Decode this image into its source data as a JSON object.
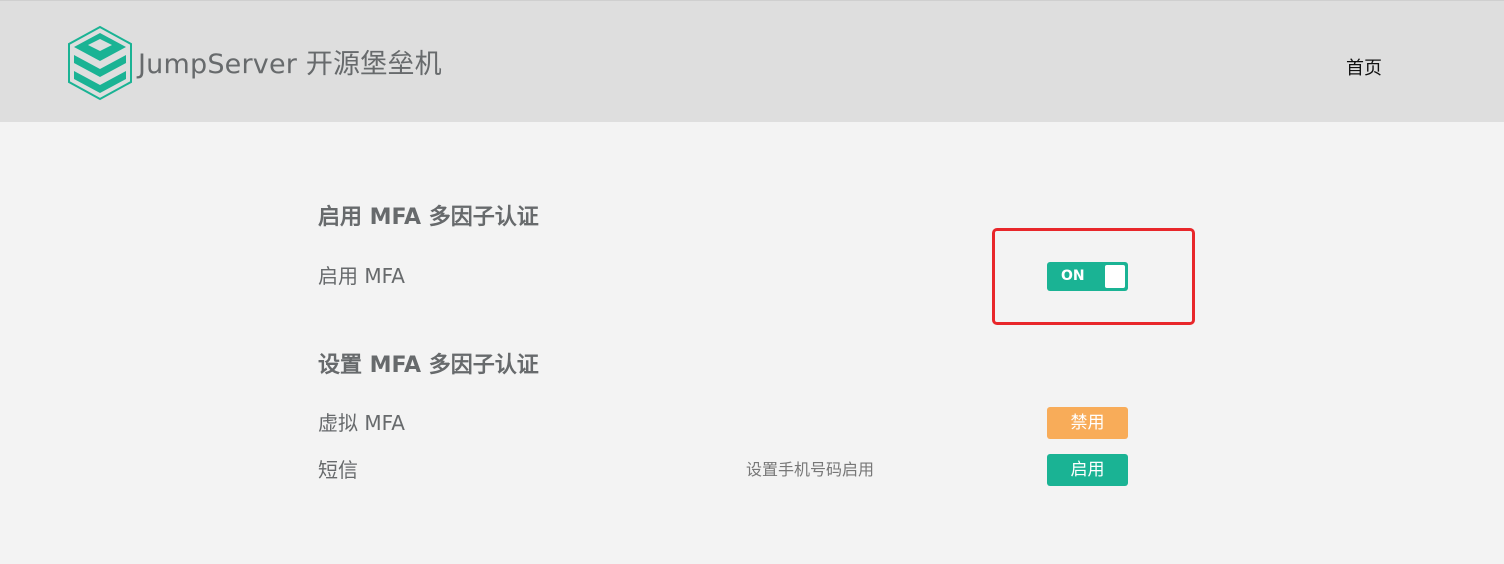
{
  "header": {
    "brand": "JumpServer 开源堡垒机",
    "nav_home": "首页"
  },
  "enable_section": {
    "title": "启用 MFA 多因子认证",
    "row_label": "启用 MFA",
    "toggle_state": "ON"
  },
  "setup_section": {
    "title": "设置 MFA 多因子认证",
    "rows": [
      {
        "label": "虚拟 MFA",
        "hint": "",
        "button": "禁用"
      },
      {
        "label": "短信",
        "hint": "设置手机号码启用",
        "button": "启用"
      }
    ]
  },
  "colors": {
    "primary": "#1ab394",
    "warning": "#f8ac59",
    "highlight": "#e8262a",
    "header_bg": "#dedede",
    "page_bg": "#f3f3f3"
  }
}
